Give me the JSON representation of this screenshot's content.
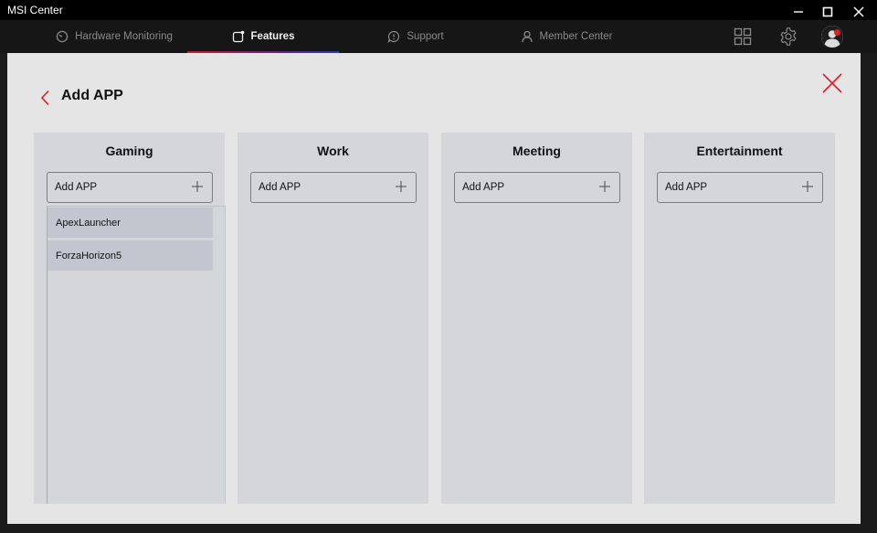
{
  "window": {
    "title": "MSI Center",
    "minimize_icon": "minimize-icon",
    "maximize_icon": "maximize-icon",
    "close_icon": "close-icon"
  },
  "nav": {
    "tabs": [
      {
        "label": "Hardware Monitoring",
        "icon": "gauge-icon",
        "active": false
      },
      {
        "label": "Features",
        "icon": "features-icon",
        "active": true
      },
      {
        "label": "Support",
        "icon": "support-icon",
        "active": false
      },
      {
        "label": "Member Center",
        "icon": "user-icon",
        "active": false
      }
    ],
    "right_icons": [
      "grid-icon",
      "gear-icon",
      "avatar-icon"
    ],
    "accent_gradient": [
      "#c8202a",
      "#6a1f8a",
      "#2a3fb0"
    ]
  },
  "dialog": {
    "title": "Add APP",
    "back_icon": "chevron-left-icon",
    "close_icon": "close-icon",
    "accent_color": "#e31b23",
    "columns": [
      {
        "title": "Gaming",
        "add_label": "Add APP",
        "apps": [
          "ApexLauncher",
          "ForzaHorizon5"
        ]
      },
      {
        "title": "Work",
        "add_label": "Add APP",
        "apps": []
      },
      {
        "title": "Meeting",
        "add_label": "Add APP",
        "apps": []
      },
      {
        "title": "Entertainment",
        "add_label": "Add APP",
        "apps": []
      }
    ]
  }
}
